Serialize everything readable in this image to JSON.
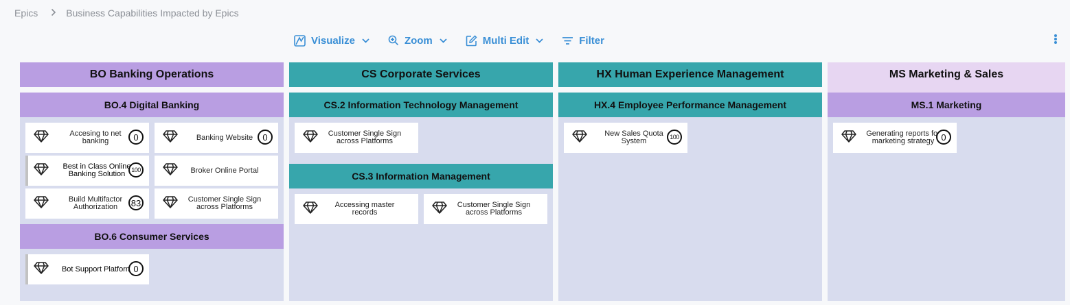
{
  "breadcrumb": {
    "root": "Epics",
    "current": "Business Capabilities Impacted by Epics"
  },
  "toolbar": {
    "visualize": "Visualize",
    "zoom": "Zoom",
    "multi_edit": "Multi Edit",
    "filter": "Filter"
  },
  "colors": {
    "purple": "#b99ee2",
    "teal": "#37a6ac",
    "light_purple": "#e7d6f2",
    "column_bg": "#d8dcee",
    "accent": "#3a8fd6"
  },
  "columns": [
    {
      "title": "BO Banking Operations",
      "sections": [
        {
          "title": "BO.4 Digital Banking",
          "cards": [
            {
              "name": "Accesing to net banking",
              "badge": "0"
            },
            {
              "name": "Banking Website",
              "badge": "0"
            },
            {
              "name": "Best in Class Online Banking Solution",
              "badge": "100"
            },
            {
              "name": "Broker Online Portal",
              "badge": ""
            },
            {
              "name": "Build Multifactor Authorization",
              "badge": "83"
            },
            {
              "name": "Customer Single Sign across Platforms",
              "badge": ""
            }
          ]
        },
        {
          "title": "BO.6 Consumer Services",
          "cards": [
            {
              "name": "Bot Support Platform",
              "badge": "0"
            }
          ]
        }
      ]
    },
    {
      "title": "CS Corporate Services",
      "sections": [
        {
          "title": "CS.2 Information Technology Management",
          "cards": [
            {
              "name": "Customer Single Sign across Platforms",
              "badge": ""
            }
          ]
        },
        {
          "title": "CS.3 Information Management",
          "cards": [
            {
              "name": "Accessing master records",
              "badge": ""
            },
            {
              "name": "Customer Single Sign across Platforms",
              "badge": ""
            }
          ]
        }
      ]
    },
    {
      "title": "HX Human Experience Management",
      "sections": [
        {
          "title": "HX.4 Employee Performance Management",
          "cards": [
            {
              "name": "New Sales Quota System",
              "badge": "100"
            }
          ]
        }
      ]
    },
    {
      "title": "MS Marketing & Sales",
      "sections": [
        {
          "title": "MS.1 Marketing",
          "cards": [
            {
              "name": "Generating reports for marketing strategy",
              "badge": "0"
            }
          ]
        }
      ]
    }
  ]
}
